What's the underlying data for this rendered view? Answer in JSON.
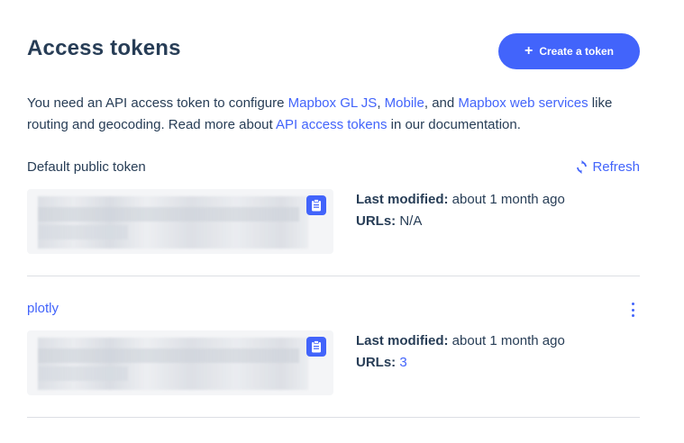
{
  "header": {
    "title": "Access tokens",
    "create_button": {
      "icon": "+",
      "label": "Create a token"
    }
  },
  "intro": {
    "t1": "You need an API access token to configure ",
    "link_gl": "Mapbox GL JS",
    "t2": ", ",
    "link_mobile": "Mobile",
    "t3": ", and ",
    "link_web": "Mapbox web services",
    "t4": " like routing and geocoding. Read more about ",
    "link_api": "API access tokens",
    "t5": " in our documentation."
  },
  "default_token": {
    "label": "Default public token",
    "refresh_label": "Refresh",
    "last_modified_label": "Last modified:",
    "last_modified_value": " about 1 month ago",
    "urls_label": "URLs:",
    "urls_value": " N/A"
  },
  "plotly_token": {
    "name": "plotly",
    "last_modified_label": "Last modified:",
    "last_modified_value": " about 1 month ago",
    "urls_label": "URLs:",
    "urls_value": "3"
  },
  "colors": {
    "accent": "#4264fb",
    "text": "#273d56",
    "token_bg": "#f4f5f7",
    "divider": "#dcdfe4"
  },
  "icons": {
    "plus": "plus-icon",
    "refresh": "refresh-icon",
    "copy": "clipboard-icon",
    "menu": "kebab-menu-icon"
  }
}
